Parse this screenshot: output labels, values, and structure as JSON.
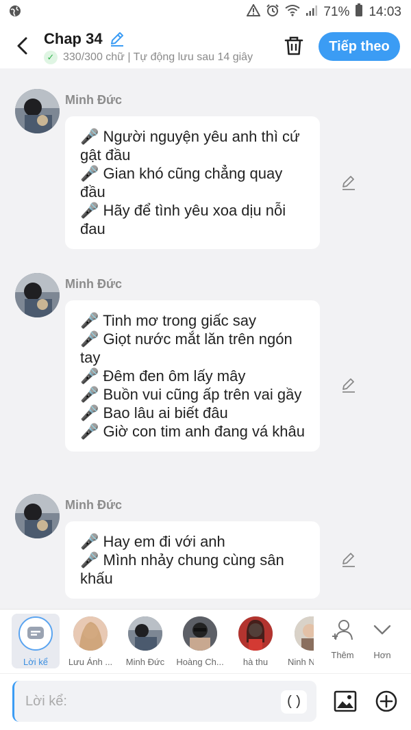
{
  "status": {
    "battery": "71%",
    "time": "14:03"
  },
  "header": {
    "title": "Chap 34",
    "subtitle": "330/300 chữ | Tự động lưu sau 14 giây",
    "next_label": "Tiếp theo"
  },
  "messages": [
    {
      "sender": "Minh Đức",
      "lines": [
        "🎤 Người nguyện yêu anh thì cứ gật đầu",
        "🎤 Gian khó cũng chẳng quay đầu",
        "🎤 Hãy để tình yêu xoa dịu nỗi đau"
      ]
    },
    {
      "sender": "Minh Đức",
      "lines": [
        "🎤 Tinh mơ trong giấc say",
        "🎤 Giọt nước mắt lăn trên ngón tay",
        "🎤 Đêm đen ôm lấy mây",
        "🎤 Buồn vui cũng ấp trên vai gầy",
        "🎤 Bao lâu ai biết đâu",
        "🎤 Giờ con tim anh đang vá khâu"
      ]
    },
    {
      "sender": "Minh Đức",
      "lines": [
        "🎤 Hay em đi với anh",
        "🎤 Mình nhảy chung cùng sân khấu"
      ]
    }
  ],
  "characters": [
    {
      "name": "Lời kể",
      "selected": true
    },
    {
      "name": "Lưu Ánh ...",
      "selected": false
    },
    {
      "name": "Minh Đức",
      "selected": false
    },
    {
      "name": "Hoàng Ch...",
      "selected": false
    },
    {
      "name": "hà thu",
      "selected": false
    },
    {
      "name": "Ninh N",
      "selected": false
    }
  ],
  "tools": {
    "add_label": "Thêm",
    "more_label": "Hơn"
  },
  "composer": {
    "placeholder": "Lời kể:",
    "paren_label": "()"
  },
  "colors": {
    "accent": "#3b9cf4",
    "background": "#f2f2f4",
    "bubble": "#ffffff"
  }
}
